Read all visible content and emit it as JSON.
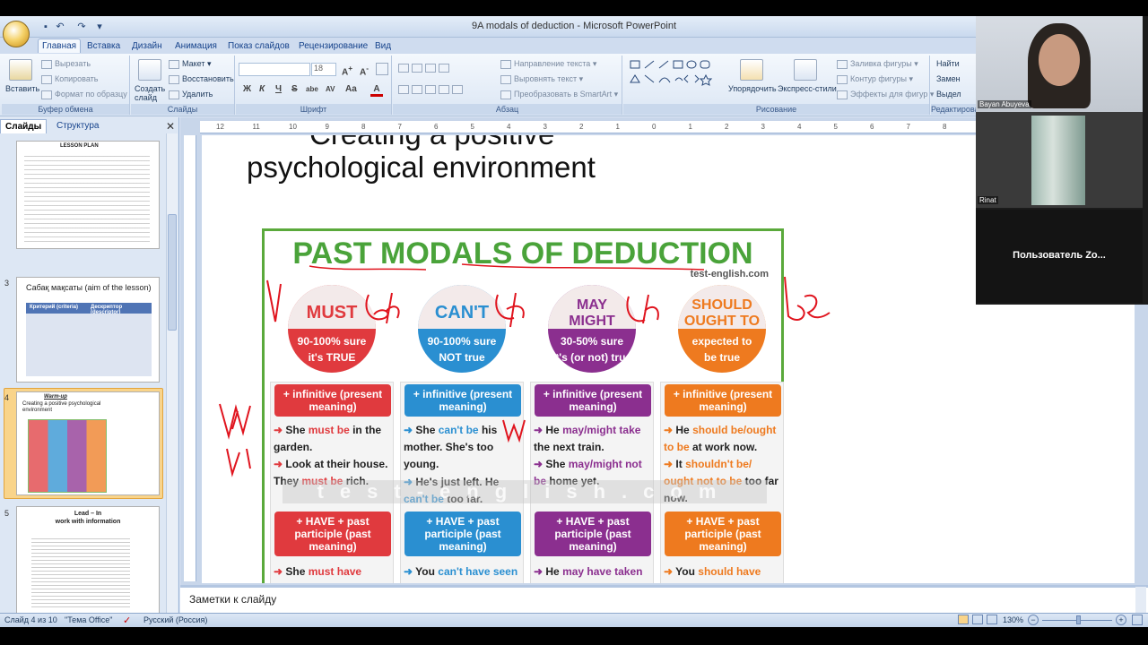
{
  "window": {
    "title": "9A modals of deduction - Microsoft PowerPoint"
  },
  "tabs": [
    "Главная",
    "Вставка",
    "Дизайн",
    "Анимация",
    "Показ слайдов",
    "Рецензирование",
    "Вид"
  ],
  "ribbon": {
    "clipboard": {
      "label": "Буфер обмена",
      "paste": "Вставить",
      "cut": "Вырезать",
      "copy": "Копировать",
      "format_painter": "Формат по образцу"
    },
    "slides": {
      "label": "Слайды",
      "new_slide": "Создать слайд",
      "layout": "Макет",
      "reset": "Восстановить",
      "delete": "Удалить"
    },
    "font": {
      "label": "Шрифт",
      "size": "18",
      "bold": "Ж",
      "italic": "К",
      "underline": "Ч",
      "strike": "S",
      "shadow": "abe",
      "spacing": "AV",
      "case": "Aa"
    },
    "paragraph": {
      "label": "Абзац",
      "text_direction": "Направление текста",
      "align_text": "Выровнять текст",
      "smartart": "Преобразовать в SmartArt"
    },
    "drawing": {
      "label": "Рисование",
      "arrange": "Упорядочить",
      "quick_styles": "Экспресс-стили",
      "shape_fill": "Заливка фигуры",
      "shape_outline": "Контур фигуры",
      "shape_effects": "Эффекты для фигур"
    },
    "editing": {
      "label": "Редактирование",
      "find": "Найти",
      "replace": "Замен",
      "select": "Выдел"
    }
  },
  "left_panel": {
    "tabs": [
      "Слайды",
      "Структура"
    ],
    "slides": [
      {
        "num": "",
        "title": "LESSON PLAN"
      },
      {
        "num": "3",
        "title": "Сабақ мақсаты (aim of the lesson)",
        "col1": "Критерий (criteria)",
        "col2": "Дескриптор (descriptor)"
      },
      {
        "num": "4",
        "title": "Warm-up",
        "subtitle": "Creating a positive psychological environment"
      },
      {
        "num": "5",
        "title": "Lead – In",
        "subtitle": "work with information"
      }
    ]
  },
  "ruler": {
    "marks": [
      "12",
      "11",
      "10",
      "9",
      "8",
      "7",
      "6",
      "5",
      "4",
      "3",
      "2",
      "1",
      "0",
      "1",
      "2",
      "3",
      "4",
      "5",
      "6",
      "7",
      "8",
      "9",
      "10",
      "11",
      "12",
      "8"
    ]
  },
  "slide": {
    "title_partial": "Creating a positive",
    "title": "psychological environment",
    "chart": {
      "heading": "PAST MODALS OF DEDUCTION",
      "site": "test-english.com",
      "watermark": "test-english.com",
      "columns": [
        {
          "modal": "MUST",
          "percent": "90-100% sure",
          "meaning": "it's TRUE",
          "color": "#e03a3e",
          "present_header": "+ infinitive (present meaning)",
          "present_examples": [
            {
              "pre": "She ",
              "modal": "must be",
              "post": " in the garden."
            },
            {
              "pre": "Look at their house. They ",
              "modal": "must be",
              "post": " rich."
            }
          ],
          "past_header": "+ HAVE + past participle (past meaning)",
          "past_example": {
            "pre": "She ",
            "modal": "must have",
            "post": ""
          }
        },
        {
          "modal": "CAN'T",
          "percent": "90-100% sure",
          "meaning": "NOT true",
          "color": "#2a8fd1",
          "present_header": "+ infinitive (present meaning)",
          "present_examples": [
            {
              "pre": "She ",
              "modal": "can't be",
              "post": " his mother. She's too young."
            },
            {
              "pre": "He's just left. He ",
              "modal": "can't be",
              "post": " too far."
            }
          ],
          "past_header": "+ HAVE + past participle (past meaning)",
          "past_example": {
            "pre": "You ",
            "modal": "can't have seen",
            "post": ""
          }
        },
        {
          "modal": "MAY MIGHT",
          "percent": "30-50% sure",
          "meaning": "it's (or not) true",
          "color": "#8b2f8f",
          "present_header": "+ infinitive (present meaning)",
          "present_examples": [
            {
              "pre": "He ",
              "modal": "may/might take",
              "post": " the next train."
            },
            {
              "pre": "She ",
              "modal": "may/might not be",
              "post": " home yet."
            }
          ],
          "past_header": "+ HAVE + past participle (past meaning)",
          "past_example": {
            "pre": "He ",
            "modal": "may have taken",
            "post": ""
          }
        },
        {
          "modal": "SHOULD OUGHT TO",
          "percent": "expected to",
          "meaning": "be true",
          "color": "#ee7a1f",
          "present_header": "+ infinitive (present meaning)",
          "present_examples": [
            {
              "pre": "He ",
              "modal": "should be/ought to be",
              "post": " at work now."
            },
            {
              "pre": "It ",
              "modal": "shouldn't be/ ought not to be",
              "post": " too far now."
            }
          ],
          "past_header": "+ HAVE + past participle (past meaning)",
          "past_example": {
            "pre": "You ",
            "modal": "should have",
            "post": ""
          }
        }
      ]
    }
  },
  "notes": {
    "placeholder": "Заметки к слайду"
  },
  "status": {
    "slide": "Слайд 4 из 10",
    "theme": "\"Тема Office\"",
    "language": "Русский (Россия)",
    "zoom": "130%"
  },
  "video": {
    "participants": [
      {
        "name": "Bayan Abuyeva"
      },
      {
        "name": "Rinat"
      },
      {
        "name": "Пользователь  Zo..."
      }
    ]
  }
}
